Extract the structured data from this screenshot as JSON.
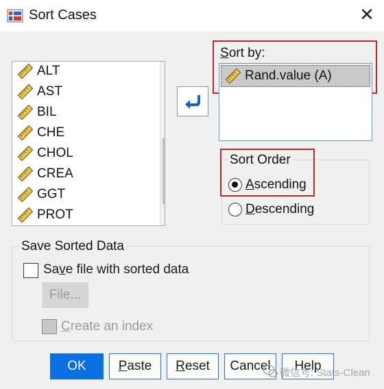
{
  "window": {
    "title": "Sort Cases",
    "close_glyph": "✕"
  },
  "variables": [
    {
      "label": "ALT",
      "icon": "ruler-icon"
    },
    {
      "label": "AST",
      "icon": "ruler-icon"
    },
    {
      "label": "BIL",
      "icon": "ruler-icon"
    },
    {
      "label": "CHE",
      "icon": "ruler-icon"
    },
    {
      "label": "CHOL",
      "icon": "ruler-icon"
    },
    {
      "label": "CREA",
      "icon": "ruler-icon"
    },
    {
      "label": "GGT",
      "icon": "ruler-icon"
    },
    {
      "label": "PROT",
      "icon": "ruler-icon"
    }
  ],
  "sort_by": {
    "label_prefix": "S",
    "label_rest": "ort by:",
    "items": [
      "Rand.value (A)"
    ]
  },
  "sort_order": {
    "title": "Sort Order",
    "ascending": {
      "u": "A",
      "rest": "scending",
      "selected": true
    },
    "descending": {
      "u": "D",
      "rest": "escending",
      "selected": false
    }
  },
  "save": {
    "title": "Save Sorted Data",
    "save_file": {
      "pre": "Sa",
      "u": "v",
      "post": "e file with sorted data",
      "checked": false
    },
    "file_button": "File...",
    "create_index": {
      "u": "C",
      "rest": "reate an index",
      "checked": false
    }
  },
  "buttons": {
    "ok": "OK",
    "paste": {
      "u": "P",
      "rest": "aste"
    },
    "reset": {
      "u": "R",
      "rest": "eset"
    },
    "cancel": "Cancel",
    "help": "Help"
  },
  "watermark": "微信号: Stats-Clean",
  "colors": {
    "highlight_red": "#c0262c",
    "accent_blue": "#0a6fe0",
    "ruler_yellow": "#e8c24a"
  }
}
